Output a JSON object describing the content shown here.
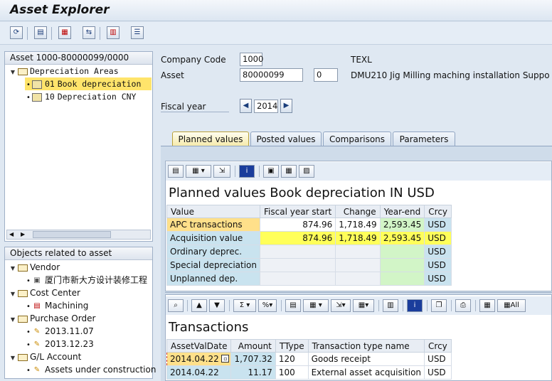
{
  "app": {
    "title": "Asset Explorer"
  },
  "toolbar": {
    "buttons": [
      "refresh-icon",
      "save-icon",
      "assets-icon",
      "transfer-icon",
      "display-icon",
      "list-icon"
    ]
  },
  "tree": {
    "header": "Asset 1000-80000099/0000",
    "group_label": "Depreciation Areas",
    "areas": [
      {
        "code": "01",
        "label": "Book depreciation"
      },
      {
        "code": "10",
        "label": "Depreciation CNY"
      }
    ]
  },
  "related": {
    "header": "Objects related to asset",
    "vendor_label": "Vendor",
    "vendor_item": "厦门市新大方设计装修工程",
    "cost_center_label": "Cost Center",
    "cost_center_item": "Machining",
    "po_label": "Purchase Order",
    "po_items": [
      "2013.11.07",
      "2013.12.23"
    ],
    "gl_label": "G/L Account",
    "gl_item": "Assets under construction"
  },
  "header_fields": {
    "company_code_label": "Company Code",
    "company_code": "1000",
    "company_name": "TEXL",
    "asset_label": "Asset",
    "asset_number": "80000099",
    "asset_sub": "0",
    "asset_description": "DMU210 Jig Milling maching installation Suppo",
    "fiscal_year_label": "Fiscal year",
    "fiscal_year": "2014"
  },
  "tabs": [
    "Planned values",
    "Posted values",
    "Comparisons",
    "Parameters"
  ],
  "planned": {
    "title": "Planned values Book depreciation IN USD",
    "columns": [
      "Value",
      "Fiscal year start",
      "Change",
      "Year-end",
      "Crcy"
    ],
    "rows": [
      {
        "label": "APC transactions",
        "start": "874.96",
        "change": "1,718.49",
        "end": "2,593.45",
        "crcy": "USD"
      },
      {
        "label": "Acquisition value",
        "start": "874.96",
        "change": "1,718.49",
        "end": "2,593.45",
        "crcy": "USD"
      },
      {
        "label": "Ordinary deprec.",
        "start": "",
        "change": "",
        "end": "",
        "crcy": "USD"
      },
      {
        "label": "Special depreciation",
        "start": "",
        "change": "",
        "end": "",
        "crcy": "USD"
      },
      {
        "label": "Unplanned dep.",
        "start": "",
        "change": "",
        "end": "",
        "crcy": "USD"
      }
    ]
  },
  "transactions": {
    "title": "Transactions",
    "all_label": "All",
    "columns": [
      "AssetValDate",
      "Amount",
      "TType",
      "Transaction type name",
      "Crcy"
    ],
    "rows": [
      {
        "date": "2014.04.22",
        "amount": "1,707.32",
        "ttype": "120",
        "name": "Goods receipt",
        "crcy": "USD"
      },
      {
        "date": "2014.04.22",
        "amount": "11.17",
        "ttype": "100",
        "name": "External asset acquisition",
        "crcy": "USD"
      }
    ]
  },
  "colors": {
    "selected": "#ffe46b",
    "label_cell": "#c9e3ef",
    "apc_row": "#ffe08a",
    "highlight": "#ffff5a",
    "year_end": "#d2f5c7"
  }
}
